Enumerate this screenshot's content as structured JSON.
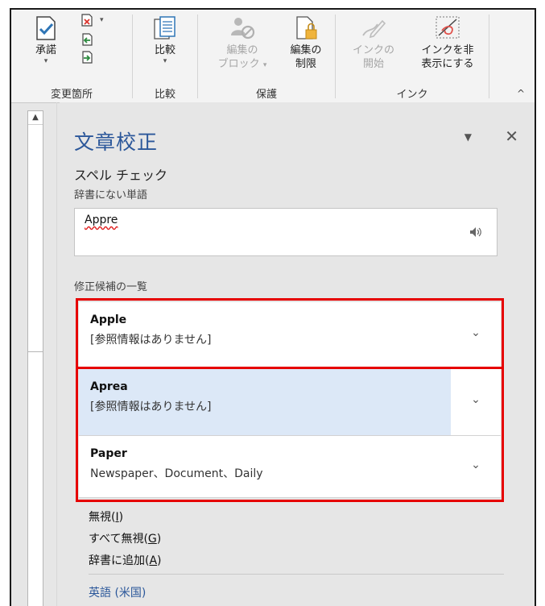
{
  "ribbon": {
    "accept_label": "承諾",
    "compare_label": "比較",
    "block_authors_label_1": "編集の",
    "block_authors_label_2": "ブロック",
    "restrict_label_1": "編集の",
    "restrict_label_2": "制限",
    "ink_start_label_1": "インクの",
    "ink_start_label_2": "開始",
    "ink_hide_label_1": "インクを非",
    "ink_hide_label_2": "表示にする",
    "groups": {
      "changes": "変更箇所",
      "compare": "比較",
      "protect": "保護",
      "ink": "インク"
    }
  },
  "pane": {
    "title": "文章校正",
    "subtitle": "スペル チェック",
    "not_in_dict": "辞書にない単語",
    "misspelled_word": "Appre",
    "suggestions_heading": "修正候補の一覧",
    "suggestions": [
      {
        "word": "Apple",
        "info": "[参照情報はありません]"
      },
      {
        "word": "Aprea",
        "info": "[参照情報はありません]"
      },
      {
        "word": "Paper",
        "info": "Newspaper、Document、Daily"
      }
    ],
    "actions": [
      {
        "text": "無視(",
        "key": "I",
        "end": ")"
      },
      {
        "text": "すべて無視(",
        "key": "G",
        "end": ")"
      },
      {
        "text": "辞書に追加(",
        "key": "A",
        "end": ")"
      }
    ],
    "language": "英語 (米国)"
  },
  "colors": {
    "accent": "#2b579a",
    "highlight": "#dce8f7",
    "annotation": "#e60000"
  }
}
